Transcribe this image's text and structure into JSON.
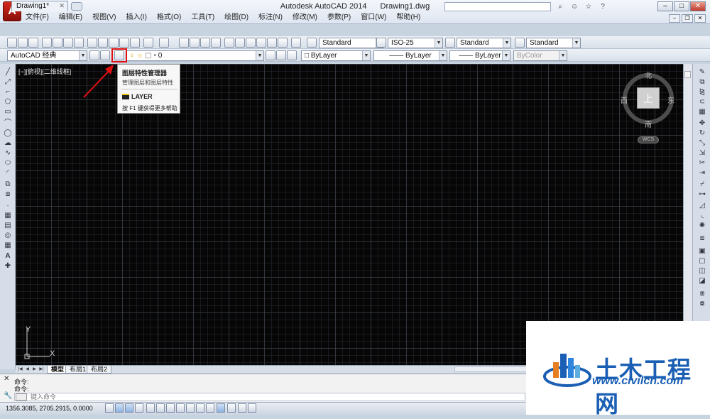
{
  "window": {
    "app_title": "Autodesk AutoCAD 2014",
    "doc_title": "Drawing1.dwg",
    "search_placeholder": "AutoCAD 经典"
  },
  "menu": [
    "文件(F)",
    "编辑(E)",
    "视图(V)",
    "插入(I)",
    "格式(O)",
    "工具(T)",
    "绘图(D)",
    "标注(N)",
    "修改(M)",
    "参数(P)",
    "窗口(W)",
    "帮助(H)"
  ],
  "tabs": {
    "document": "Drawing1*",
    "close": "✕"
  },
  "toolbar1": {
    "text_style": "Standard",
    "dim_style": "ISO-25",
    "table_style": "Standard",
    "multileader_style": "Standard"
  },
  "toolbar2": {
    "workspace": "AutoCAD 经典",
    "layer": "0",
    "color": "ByLayer",
    "linetype": "ByLayer",
    "lineweight": "ByLayer",
    "plot_style": "ByColor"
  },
  "viewport_label": "[−][俯视][二维线框]",
  "viewcube": {
    "north": "北",
    "south": "南",
    "west": "西",
    "east": "东",
    "top": "上",
    "wcs": "WCS"
  },
  "ucs": {
    "x": "X",
    "y": "Y"
  },
  "tooltip": {
    "title": "图层特性管理器",
    "description": "管理图层和图层特性",
    "command": "LAYER",
    "help": "按 F1 键获得更多帮助"
  },
  "layout_tabs": [
    "模型",
    "布局1",
    "布局2"
  ],
  "command": {
    "history": [
      "命令:",
      "命令:"
    ],
    "placeholder": "键入命令"
  },
  "status": {
    "coords": "1356.3085, 2705.2915, 0.0000"
  },
  "watermark": {
    "title": "土木工程网",
    "url": "www.civilcn.com"
  },
  "colors": {
    "highlight": "#e01010",
    "canvas": "#060606",
    "brand": "#1a5fb4"
  }
}
